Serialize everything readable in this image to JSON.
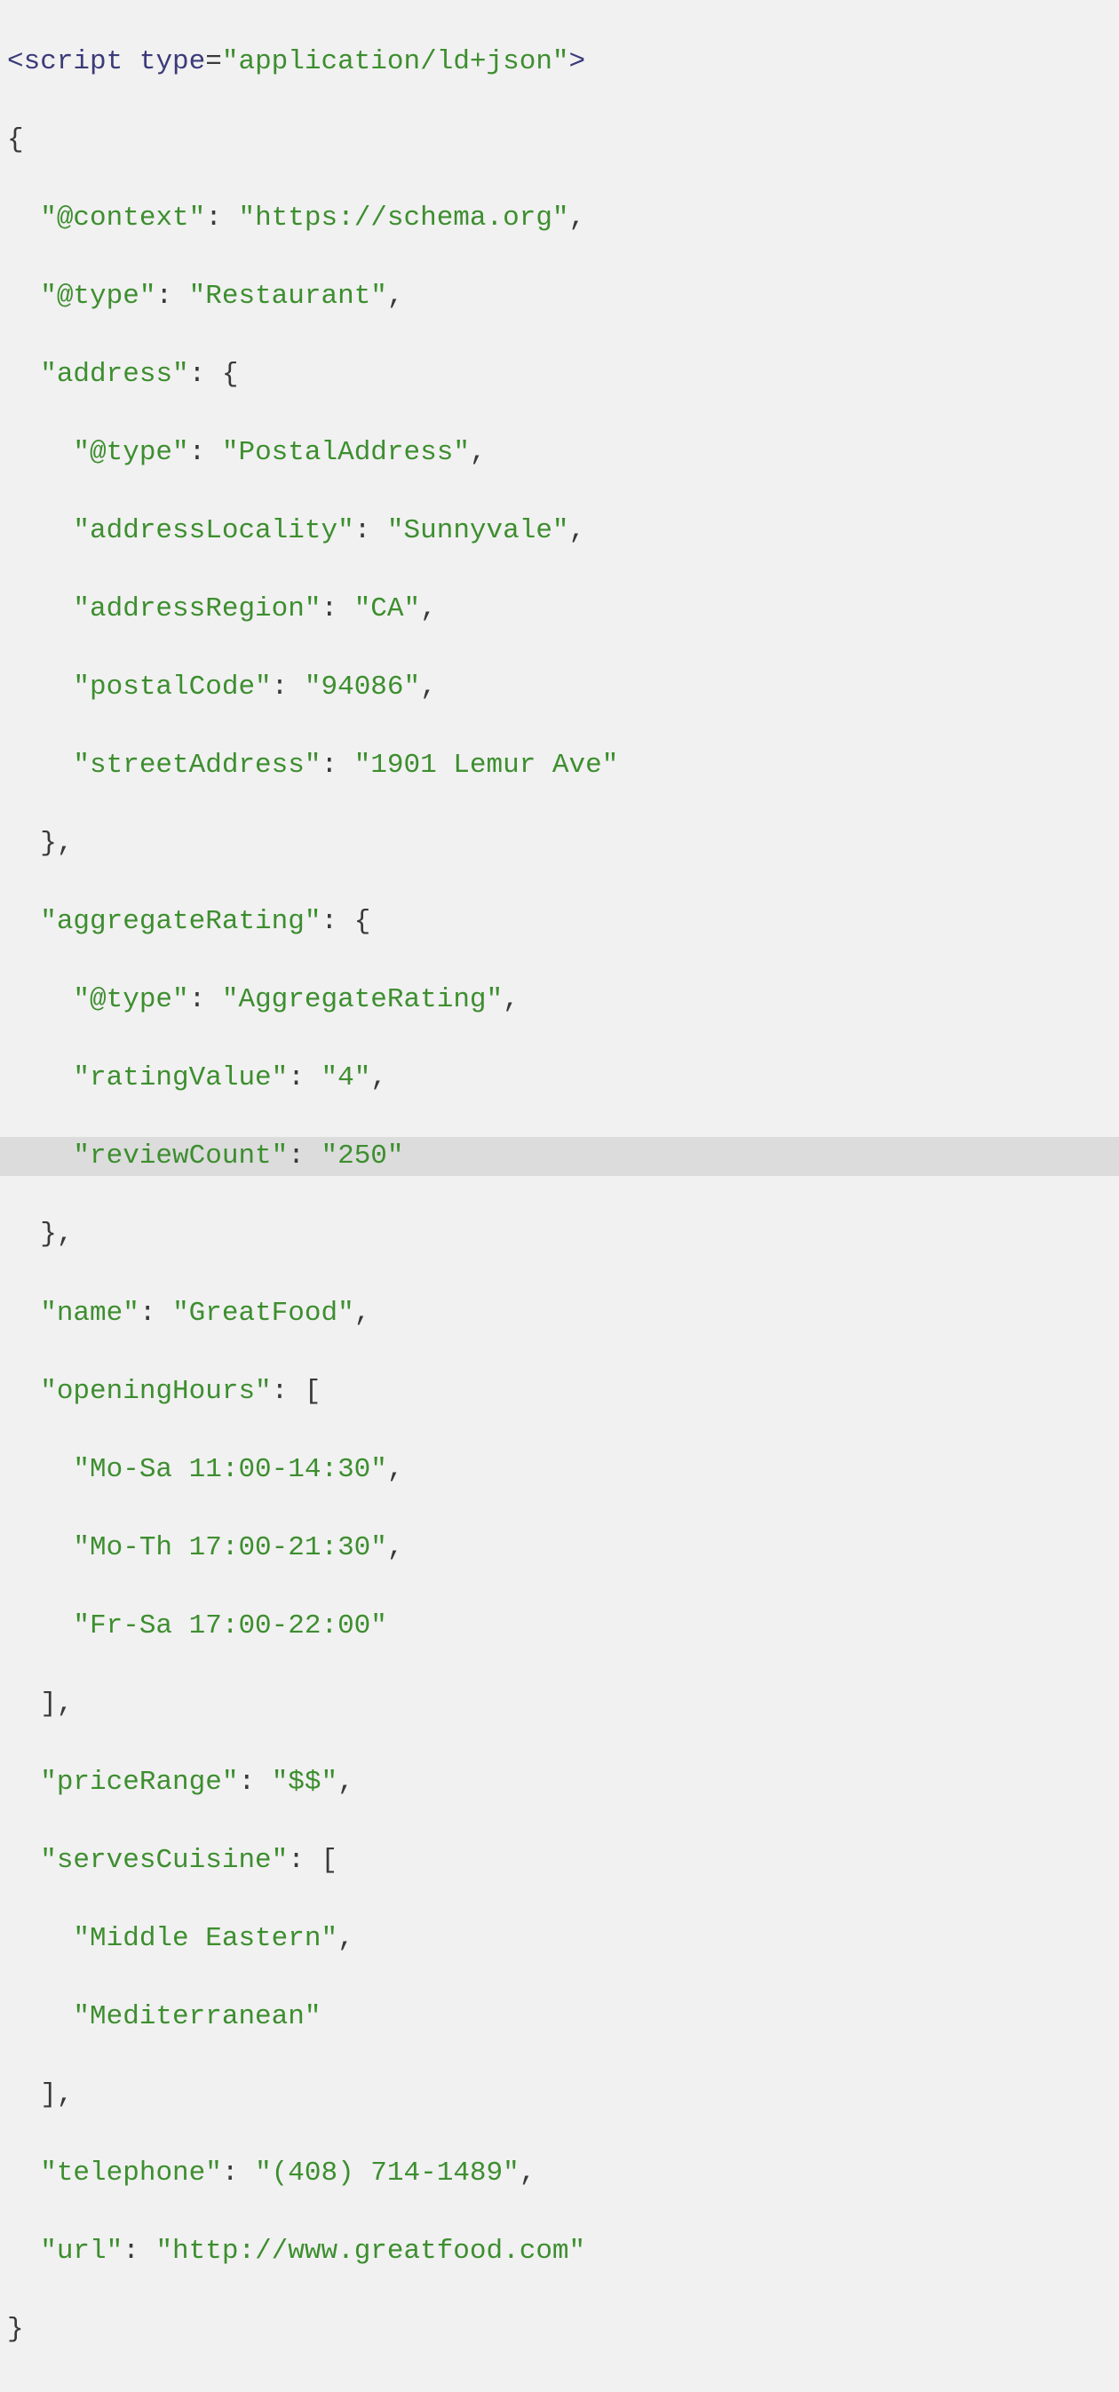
{
  "code": {
    "scriptOpen": {
      "lt": "<",
      "tag": "script",
      "attrName": "type",
      "eq": "=",
      "attrVal": "\"application/ld+json\"",
      "gt": ">"
    },
    "braceOpen": "{",
    "context": {
      "key": "\"@context\"",
      "colon": ": ",
      "val": "\"https://schema.org\"",
      "comma": ","
    },
    "type": {
      "key": "\"@type\"",
      "colon": ": ",
      "val": "\"Restaurant\"",
      "comma": ","
    },
    "addressKey": {
      "key": "\"address\"",
      "colon": ": ",
      "brace": "{"
    },
    "addrType": {
      "key": "\"@type\"",
      "colon": ": ",
      "val": "\"PostalAddress\"",
      "comma": ","
    },
    "addrLocality": {
      "key": "\"addressLocality\"",
      "colon": ": ",
      "val": "\"Sunnyvale\"",
      "comma": ","
    },
    "addrRegion": {
      "key": "\"addressRegion\"",
      "colon": ": ",
      "val": "\"CA\"",
      "comma": ","
    },
    "postalCode": {
      "key": "\"postalCode\"",
      "colon": ": ",
      "val": "\"94086\"",
      "comma": ","
    },
    "streetAddr": {
      "key": "\"streetAddress\"",
      "colon": ": ",
      "val": "\"1901 Lemur Ave\""
    },
    "addrClose": "},",
    "aggKey": {
      "key": "\"aggregateRating\"",
      "colon": ": ",
      "brace": "{"
    },
    "aggType": {
      "key": "\"@type\"",
      "colon": ": ",
      "val": "\"AggregateRating\"",
      "comma": ","
    },
    "ratingValue": {
      "key": "\"ratingValue\"",
      "colon": ": ",
      "val": "\"4\"",
      "comma": ","
    },
    "reviewCount": {
      "key": "\"reviewCount\"",
      "colon": ": ",
      "val": "\"250\""
    },
    "aggClose": "},",
    "name": {
      "key": "\"name\"",
      "colon": ": ",
      "val": "\"GreatFood\"",
      "comma": ","
    },
    "openingKey": {
      "key": "\"openingHours\"",
      "colon": ": ",
      "bracket": "["
    },
    "hours1": {
      "val": "\"Mo-Sa 11:00-14:30\"",
      "comma": ","
    },
    "hours2": {
      "val": "\"Mo-Th 17:00-21:30\"",
      "comma": ","
    },
    "hours3": {
      "val": "\"Fr-Sa 17:00-22:00\""
    },
    "openingClose": "],",
    "priceRange": {
      "key": "\"priceRange\"",
      "colon": ": ",
      "val": "\"$$\"",
      "comma": ","
    },
    "cuisineKey": {
      "key": "\"servesCuisine\"",
      "colon": ": ",
      "bracket": "["
    },
    "cuisine1": {
      "val": "\"Middle Eastern\"",
      "comma": ","
    },
    "cuisine2": {
      "val": "\"Mediterranean\""
    },
    "cuisineClose": "],",
    "telephone": {
      "key": "\"telephone\"",
      "colon": ": ",
      "val": "\"(408) 714-1489\"",
      "comma": ","
    },
    "url": {
      "key": "\"url\"",
      "colon": ": ",
      "val": "\"http://www.greatfood.com\""
    },
    "braceClose": "}"
  }
}
